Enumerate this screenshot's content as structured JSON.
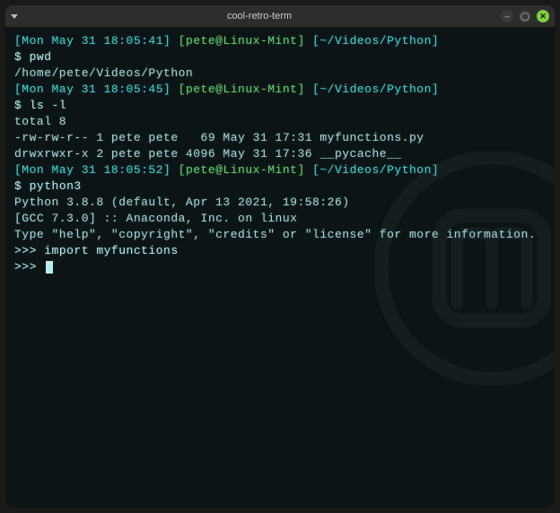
{
  "window": {
    "title": "cool-retro-term"
  },
  "colors": {
    "cyan": "#3bd4d4",
    "green": "#5fd65f",
    "text": "#b6f0ee"
  },
  "prompts": [
    {
      "time": "[Mon May 31 18:05:41]",
      "user_host": "[pete@Linux-Mint]",
      "path": "[~/Videos/Python]",
      "cmd_prefix": "$ ",
      "cmd": "pwd"
    },
    {
      "time": "[Mon May 31 18:05:45]",
      "user_host": "[pete@Linux-Mint]",
      "path": "[~/Videos/Python]",
      "cmd_prefix": "$ ",
      "cmd": "ls -l"
    },
    {
      "time": "[Mon May 31 18:05:52]",
      "user_host": "[pete@Linux-Mint]",
      "path": "[~/Videos/Python]",
      "cmd_prefix": "$ ",
      "cmd": "python3"
    }
  ],
  "outputs": {
    "pwd": "/home/pete/Videos/Python",
    "ls_total": "total 8",
    "ls_row1": "-rw-rw-r-- 1 pete pete   69 May 31 17:31 myfunctions.py",
    "ls_row2": "drwxrwxr-x 2 pete pete 4096 May 31 17:36 __pycache__",
    "py_version": "Python 3.8.8 (default, Apr 13 2021, 19:58:26)",
    "py_gcc": "[GCC 7.3.0] :: Anaconda, Inc. on linux",
    "py_help": "Type \"help\", \"copyright\", \"credits\" or \"license\" for more information.",
    "py_prompt1_prefix": ">>> ",
    "py_prompt1_cmd": "import myfunctions",
    "py_prompt2_prefix": ">>> "
  }
}
